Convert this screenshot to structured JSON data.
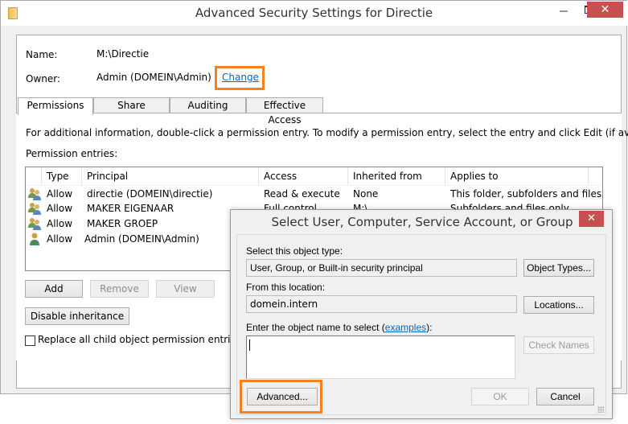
{
  "main_window": {
    "title": "Advanced Security Settings for Directie",
    "icon": "folder-icon",
    "controls": {
      "minimize": "—",
      "maximize": "☐",
      "close": "✕"
    },
    "name_label": "Name:",
    "name_value": "M:\\Directie",
    "owner_label": "Owner:",
    "owner_value": "Admin (DOMEIN\\Admin)",
    "change_link": "Change",
    "tabs": [
      {
        "label": "Permissions",
        "active": true
      },
      {
        "label": "Share",
        "active": false
      },
      {
        "label": "Auditing",
        "active": false
      },
      {
        "label": "Effective Access",
        "active": false
      }
    ],
    "info_text": "For additional information, double-click a permission entry. To modify a permission entry, select the entry and click Edit (if available).",
    "entries_label": "Permission entries:",
    "columns": [
      "Type",
      "Principal",
      "Access",
      "Inherited from",
      "Applies to"
    ],
    "rows": [
      {
        "icon": "group-icon",
        "type": "Allow",
        "principal": "directie (DOMEIN\\directie)",
        "access": "Read & execute",
        "inherited": "None",
        "applies": "This folder, subfolders and files"
      },
      {
        "icon": "group-icon",
        "type": "Allow",
        "principal": "MAKER EIGENAAR",
        "access": "Full control",
        "inherited": "M:\\",
        "applies": "Subfolders and files only"
      },
      {
        "icon": "group-icon",
        "type": "Allow",
        "principal": "MAKER GROEP",
        "access": "",
        "inherited": "",
        "applies": ""
      },
      {
        "icon": "user-icon",
        "type": "Allow",
        "principal": "Admin (DOMEIN\\Admin)",
        "access": "",
        "inherited": "",
        "applies": ""
      }
    ],
    "buttons": {
      "add": "Add",
      "remove": "Remove",
      "view": "View",
      "disable_inheritance": "Disable inheritance"
    },
    "replace_checkbox_label": "Replace all child object permission entries wit",
    "replace_checked": false
  },
  "dialog": {
    "title": "Select User, Computer, Service Account, or Group",
    "close": "✕",
    "object_type_label": "Select this object type:",
    "object_type_value": "User, Group, or Built-in security principal",
    "object_types_button": "Object Types...",
    "location_label": "From this location:",
    "location_value": "domein.intern",
    "locations_button": "Locations...",
    "enter_name_label_pre": "Enter the object name to select (",
    "examples_link": "examples",
    "enter_name_label_post": "):",
    "name_input_value": "",
    "check_names_button": "Check Names",
    "advanced_button": "Advanced...",
    "ok_button": "OK",
    "cancel_button": "Cancel"
  },
  "highlight_color": "#f58220",
  "close_button_color": "#c75050"
}
